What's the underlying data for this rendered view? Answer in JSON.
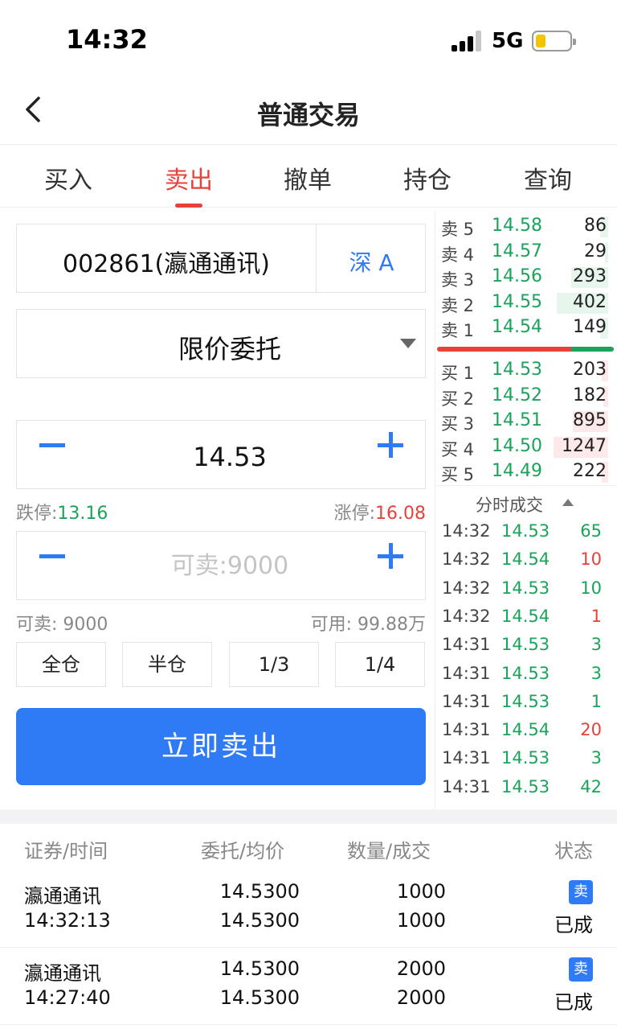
{
  "status_bar": {
    "time": "14:32",
    "network": "5G"
  },
  "header": {
    "title": "普通交易"
  },
  "tabs": [
    {
      "label": "买入"
    },
    {
      "label": "卖出",
      "active": true
    },
    {
      "label": "撤单"
    },
    {
      "label": "持仓"
    },
    {
      "label": "查询"
    }
  ],
  "form": {
    "stock": "002861(瀛通通讯)",
    "market": "深 A",
    "order_type": "限价委托",
    "price": "14.53",
    "limit_down_label": "跌停:",
    "limit_down": "13.16",
    "limit_up_label": "涨停:",
    "limit_up": "16.08",
    "qty_placeholder": "可卖:9000",
    "sellable_label": "可卖: 9000",
    "available_label": "可用: 99.88万",
    "position_buttons": [
      "全仓",
      "半仓",
      "1/3",
      "1/4"
    ],
    "submit_label": "立即卖出"
  },
  "order_book": {
    "asks": [
      {
        "label": "卖 5",
        "price": "14.58",
        "volume": "86",
        "depth": 0.05
      },
      {
        "label": "卖 4",
        "price": "14.57",
        "volume": "29",
        "depth": 0.02
      },
      {
        "label": "卖 3",
        "price": "14.56",
        "volume": "293",
        "depth": 0.23
      },
      {
        "label": "卖 2",
        "price": "14.55",
        "volume": "402",
        "depth": 0.32
      },
      {
        "label": "卖 1",
        "price": "14.54",
        "volume": "149",
        "depth": 0.05
      }
    ],
    "bids": [
      {
        "label": "买 1",
        "price": "14.53",
        "volume": "203",
        "depth": 0.04
      },
      {
        "label": "买 2",
        "price": "14.52",
        "volume": "182",
        "depth": 0.03
      },
      {
        "label": "买 3",
        "price": "14.51",
        "volume": "895",
        "depth": 0.22
      },
      {
        "label": "买 4",
        "price": "14.50",
        "volume": "1247",
        "depth": 0.34
      },
      {
        "label": "买 5",
        "price": "14.49",
        "volume": "222",
        "depth": 0.04
      }
    ],
    "sell_ratio": 0.76,
    "colors": {
      "ask_fill": "#e6f6ec",
      "bid_fill": "#fde8ea",
      "sell_bar": "#e8403a",
      "buy_bar": "#1aa35a"
    }
  },
  "ticks": {
    "title": "分时成交",
    "rows": [
      {
        "time": "14:32",
        "price": "14.53",
        "qty": "65",
        "side": "sell"
      },
      {
        "time": "14:32",
        "price": "14.54",
        "qty": "10",
        "side": "buy"
      },
      {
        "time": "14:32",
        "price": "14.53",
        "qty": "10",
        "side": "sell"
      },
      {
        "time": "14:32",
        "price": "14.54",
        "qty": "1",
        "side": "buy"
      },
      {
        "time": "14:31",
        "price": "14.53",
        "qty": "3",
        "side": "sell"
      },
      {
        "time": "14:31",
        "price": "14.53",
        "qty": "3",
        "side": "sell"
      },
      {
        "time": "14:31",
        "price": "14.53",
        "qty": "1",
        "side": "sell"
      },
      {
        "time": "14:31",
        "price": "14.54",
        "qty": "20",
        "side": "buy"
      },
      {
        "time": "14:31",
        "price": "14.53",
        "qty": "3",
        "side": "sell"
      },
      {
        "time": "14:31",
        "price": "14.53",
        "qty": "42",
        "side": "sell"
      }
    ]
  },
  "orders": {
    "headers": [
      "证券/时间",
      "委托/均价",
      "数量/成交",
      "状态"
    ],
    "rows": [
      {
        "name": "瀛通通讯",
        "time": "14:32:13",
        "order_price": "14.5300",
        "avg_price": "14.5300",
        "quantity": "1000",
        "filled": "1000",
        "side": "卖",
        "status": "已成"
      },
      {
        "name": "瀛通通讯",
        "time": "14:27:40",
        "order_price": "14.5300",
        "avg_price": "14.5300",
        "quantity": "2000",
        "filled": "2000",
        "side": "卖",
        "status": "已成"
      }
    ]
  }
}
